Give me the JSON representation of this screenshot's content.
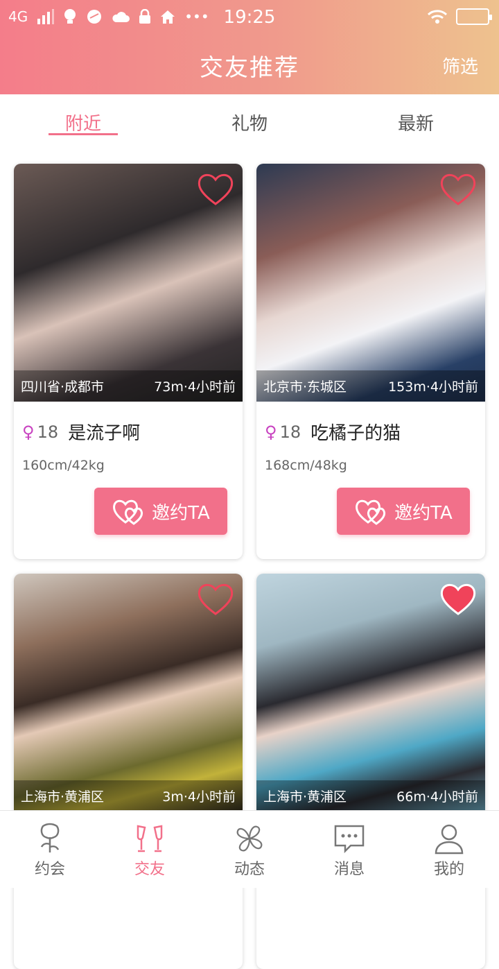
{
  "status_bar": {
    "network": "4G",
    "time": "19:25"
  },
  "header": {
    "title": "交友推荐",
    "filter_label": "筛选"
  },
  "tabs": [
    {
      "label": "附近",
      "active": true
    },
    {
      "label": "礼物",
      "active": false
    },
    {
      "label": "最新",
      "active": false
    }
  ],
  "cards": [
    {
      "location": "四川省·成都市",
      "meta": "73m·4小时前",
      "gender_symbol": "♀",
      "age": "18",
      "name": "是流子啊",
      "stats": "160cm/42kg",
      "invite_label": "邀约TA",
      "favorited": false
    },
    {
      "location": "北京市·东城区",
      "meta": "153m·4小时前",
      "gender_symbol": "♀",
      "age": "18",
      "name": "吃橘子的猫",
      "stats": "168cm/48kg",
      "invite_label": "邀约TA",
      "favorited": false
    },
    {
      "location": "上海市·黄浦区",
      "meta": "3m·4小时前",
      "favorited": false
    },
    {
      "location": "上海市·黄浦区",
      "meta": "66m·4小时前",
      "favorited": true
    }
  ],
  "nav": [
    {
      "label": "约会",
      "icon": "rose-icon",
      "active": false
    },
    {
      "label": "交友",
      "icon": "champagne-icon",
      "active": true
    },
    {
      "label": "动态",
      "icon": "pinwheel-icon",
      "active": false
    },
    {
      "label": "消息",
      "icon": "chat-bubble-icon",
      "active": false
    },
    {
      "label": "我的",
      "icon": "user-icon",
      "active": false
    }
  ],
  "colors": {
    "accent": "#f2708a",
    "header_start": "#f47d8a",
    "header_end": "#eec28e",
    "heart_fill": "#f0435a"
  }
}
